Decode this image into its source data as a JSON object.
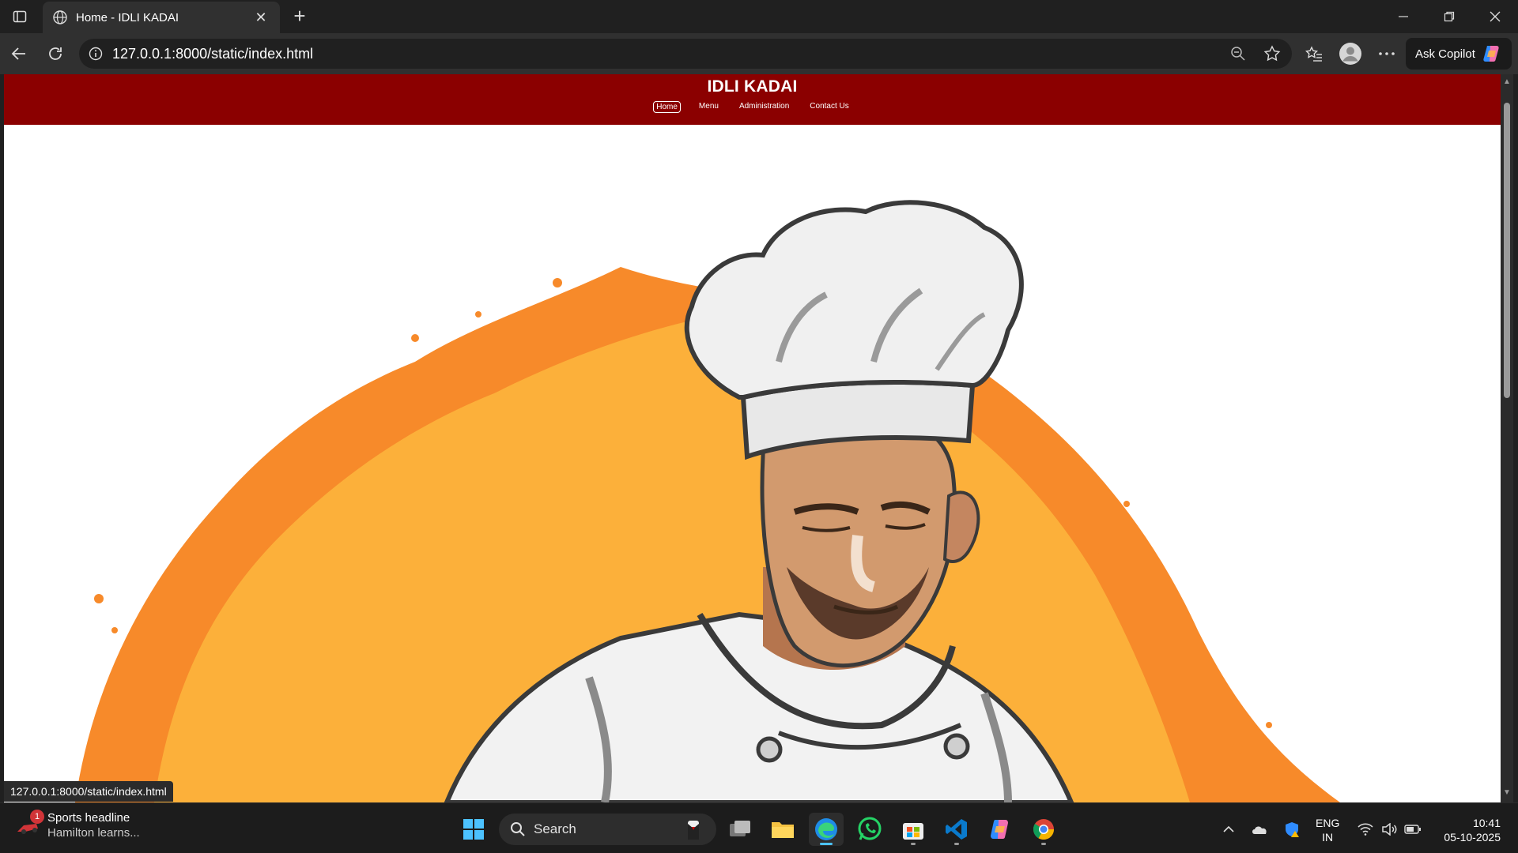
{
  "browser": {
    "tab_title": "Home - IDLI KADAI",
    "address_url": "127.0.0.1:8000/static/index.html",
    "ask_copilot_label": "Ask Copilot",
    "status_url": "127.0.0.1:8000/static/index.html"
  },
  "site": {
    "title": "IDLI KADAI",
    "nav": [
      {
        "label": "Home",
        "active": true
      },
      {
        "label": "Menu",
        "active": false
      },
      {
        "label": "Administration",
        "active": false
      },
      {
        "label": "Contact Us",
        "active": false
      }
    ],
    "colors": {
      "header_bg": "#8b0000",
      "header_text": "#ffffff",
      "hero_orange": "#fcb03a",
      "hero_deep_orange": "#f78a2a"
    }
  },
  "taskbar": {
    "news_badge": "1",
    "news_headline": "Sports headline",
    "news_sub": "Hamilton learns...",
    "search_label": "Search",
    "lang_line1": "ENG",
    "lang_line2": "IN",
    "time": "10:41",
    "date": "05-10-2025",
    "apps": [
      "windows-start",
      "task-view",
      "file-explorer",
      "edge",
      "whatsapp",
      "microsoft-store",
      "vscode",
      "copilot",
      "chrome"
    ]
  }
}
